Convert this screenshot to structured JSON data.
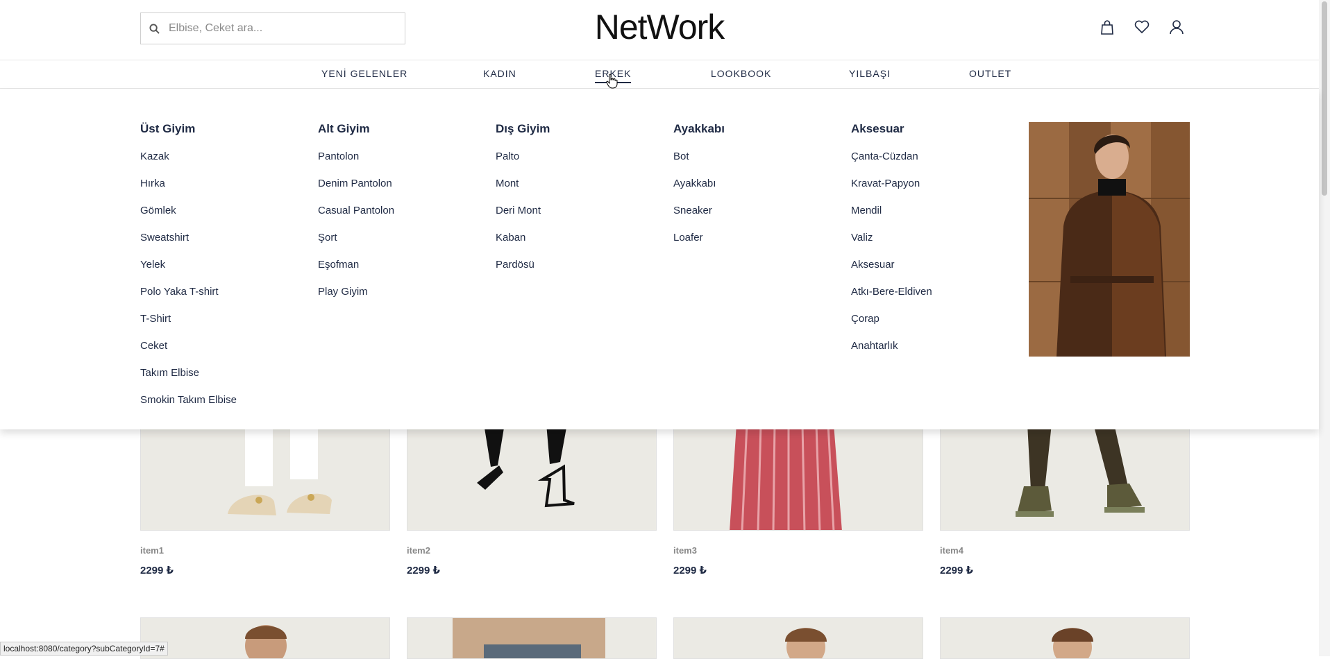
{
  "brand": {
    "logo_text": "NetWork"
  },
  "search": {
    "placeholder": "Elbise, Ceket ara..."
  },
  "nav": {
    "items": [
      {
        "label": "YENİ GELENLER"
      },
      {
        "label": "KADIN"
      },
      {
        "label": "ERKEK",
        "active": true
      },
      {
        "label": "LOOKBOOK"
      },
      {
        "label": "YILBAŞI"
      },
      {
        "label": "OUTLET"
      }
    ]
  },
  "mega": {
    "columns": [
      {
        "title": "Üst Giyim",
        "links": [
          "Kazak",
          "Hırka",
          "Gömlek",
          "Sweatshirt",
          "Yelek",
          "Polo Yaka T-shirt",
          "T-Shirt",
          "Ceket",
          "Takım Elbise",
          "Smokin Takım Elbise"
        ]
      },
      {
        "title": "Alt Giyim",
        "links": [
          "Pantolon",
          "Denim Pantolon",
          "Casual Pantolon",
          "Şort",
          "Eşofman",
          "Play Giyim"
        ]
      },
      {
        "title": "Dış Giyim",
        "links": [
          "Palto",
          "Mont",
          "Deri Mont",
          "Kaban",
          "Pardösü"
        ]
      },
      {
        "title": "Ayakkabı",
        "links": [
          "Bot",
          "Ayakkabı",
          "Sneaker",
          "Loafer"
        ]
      },
      {
        "title": "Aksesuar",
        "links": [
          "Çanta-Cüzdan",
          "Kravat-Papyon",
          "Mendil",
          "Valiz",
          "Aksesuar",
          "Atkı-Bere-Eldiven",
          "Çorap",
          "Anahtarlık"
        ]
      }
    ]
  },
  "products": [
    {
      "name": "item1",
      "price": "2299 ₺"
    },
    {
      "name": "item2",
      "price": "2299 ₺"
    },
    {
      "name": "item3",
      "price": "2299 ₺"
    },
    {
      "name": "item4",
      "price": "2299 ₺"
    }
  ],
  "status_url": "localhost:8080/category?subCategoryId=7#",
  "icons": [
    "search-icon",
    "bag-icon",
    "heart-icon",
    "user-icon"
  ]
}
